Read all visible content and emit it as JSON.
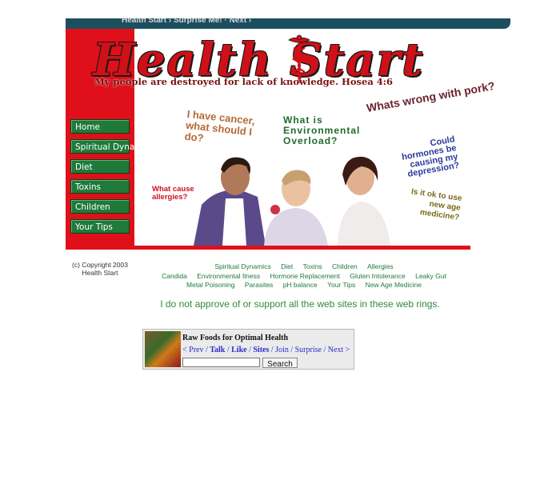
{
  "top_nav": {
    "text": "Health Start › Surprise Me! · Next ›"
  },
  "banner": {
    "logo_text": "Health Start",
    "tagline": "My people are destroyed for lack of knowledge. Hosea 4:6",
    "nav": [
      "Home",
      "Spiritual Dynamics",
      "Diet",
      "Toxins",
      "Children",
      "Your Tips"
    ],
    "questions": {
      "cancer": "I have cancer, what should I do?",
      "overload": "What is Environmental Overload?",
      "pork": "Whats wrong with pork?",
      "hormones": "Could hormones be causing my depression?",
      "allergies": "What causes allergies?",
      "new_age": "Is it ok to use new age medicine?"
    }
  },
  "footer": {
    "copyright": "(c) Copyright 2003 Health Start",
    "links_row1": [
      "Spiritual Dynamics",
      "Diet",
      "Toxins",
      "Children",
      "Allergies"
    ],
    "links_row2": [
      "Candida",
      "Environmental Ilness",
      "Hormone Replacement",
      "Gluten Intolerance",
      "Leaky Gut"
    ],
    "links_row3": [
      "Metal Poisoning",
      "Parasites",
      "pH balance",
      "Your Tips",
      "New Age Medicine"
    ],
    "disclaimer": "I do not approve of or support all the web sites in these web rings."
  },
  "webring": {
    "title": "Raw Foods for Optimal Health",
    "nav_prev": "< Prev",
    "nav_talk": "Talk",
    "nav_like": "Like",
    "nav_sites": "Sites",
    "nav_join": "Join",
    "nav_surprise": "Surprise",
    "nav_next": "Next >",
    "search_button": "Search"
  },
  "colors": {
    "accent_red": "#e0101a",
    "nav_green": "#1f7a3a",
    "link_green": "#2e8b3a"
  }
}
